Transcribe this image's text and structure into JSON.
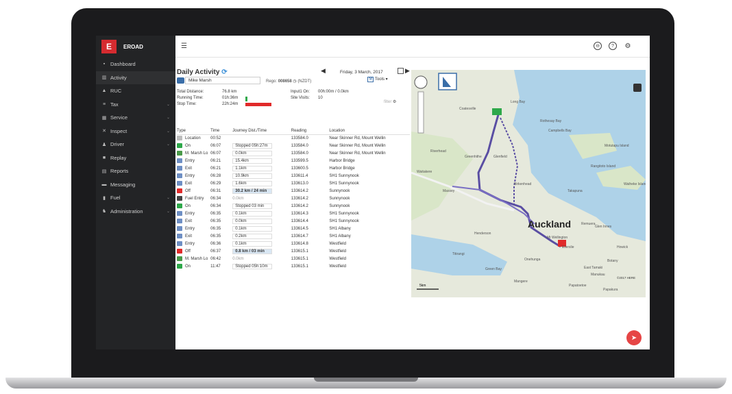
{
  "app": {
    "brand_letter": "E",
    "brand_name": "EROAD"
  },
  "sidebar": {
    "items": [
      {
        "label": "Dashboard",
        "icon": "dashboard-icon",
        "glyph": "▪",
        "chevron": false
      },
      {
        "label": "Activity",
        "icon": "activity-icon",
        "glyph": "▥",
        "chevron": false
      },
      {
        "label": "RUC",
        "icon": "ruc-icon",
        "glyph": "▲",
        "chevron": false
      },
      {
        "label": "Tax",
        "icon": "tax-icon",
        "glyph": "≡",
        "chevron": true
      },
      {
        "label": "Service",
        "icon": "service-icon",
        "glyph": "▦",
        "chevron": true
      },
      {
        "label": "Inspect",
        "icon": "inspect-icon",
        "glyph": "✕",
        "chevron": true
      },
      {
        "label": "Driver",
        "icon": "driver-icon",
        "glyph": "♟",
        "chevron": true
      },
      {
        "label": "Replay",
        "icon": "replay-icon",
        "glyph": "■",
        "chevron": false
      },
      {
        "label": "Reports",
        "icon": "reports-icon",
        "glyph": "▤",
        "chevron": false
      },
      {
        "label": "Messaging",
        "icon": "messaging-icon",
        "glyph": "▬",
        "chevron": false
      },
      {
        "label": "Fuel",
        "icon": "fuel-icon",
        "glyph": "▮",
        "chevron": true
      },
      {
        "label": "Administration",
        "icon": "administration-icon",
        "glyph": "♞",
        "chevron": true
      }
    ]
  },
  "header": {
    "menu_glyph": "☰",
    "icons": [
      "⊖",
      "?",
      "⚙"
    ]
  },
  "activity": {
    "title": "Daily Activity",
    "date": "Friday, 3 March, 2017",
    "driver": "Mike Marsh",
    "rego_label": "Rego:",
    "rego_value": "008658",
    "rego_region": "(NZDT)",
    "tools_label": "Tools",
    "filter_label": "filter",
    "stats": {
      "total_distance_label": "Total Distance:",
      "total_distance": "76.8 km",
      "running_time_label": "Running Time:",
      "running_time": "01h:36m",
      "stop_time_label": "Stop Time:",
      "stop_time": "22h:24m",
      "input_on_label": "Input1 On:",
      "input_on": "00h:00m / 0.0km",
      "site_visits_label": "Site Visits:",
      "site_visits": "10"
    },
    "columns": [
      "Type",
      "Time",
      "Journey Dist./Time",
      "Reading",
      "Location"
    ],
    "rows": [
      {
        "type": "Location",
        "time": "00:52",
        "journey": "",
        "reading": "133584.0",
        "location": "Near Skinner Rd, Mount Wellin",
        "color": "#bdbdbd",
        "boxed": false,
        "hl": false
      },
      {
        "type": "On",
        "time": "06:07",
        "journey": "Stopped  05h:27m",
        "reading": "133584.0",
        "location": "Near Skinner Rd, Mount Wellin",
        "color": "#2ea84a",
        "boxed": true,
        "hl": false
      },
      {
        "type": "M. Marsh Lo",
        "time": "06:07",
        "journey": "0.0km",
        "reading": "133584.0",
        "location": "Near Skinner Rd, Mount Wellin",
        "color": "#4a9a4a",
        "boxed": true,
        "hl": false
      },
      {
        "type": "Entry",
        "time": "06:21",
        "journey": "15.4km",
        "reading": "133599.5",
        "location": "Harbor Bridge",
        "color": "#6e8fc4",
        "boxed": true,
        "hl": false
      },
      {
        "type": "Exit",
        "time": "06:21",
        "journey": "1.1km",
        "reading": "133600.5",
        "location": "Harbor Bridge",
        "color": "#6e8fc4",
        "boxed": true,
        "hl": false
      },
      {
        "type": "Entry",
        "time": "06:28",
        "journey": "10.9km",
        "reading": "133611.4",
        "location": "SH1 Sunnynook",
        "color": "#6e8fc4",
        "boxed": true,
        "hl": false
      },
      {
        "type": "Exit",
        "time": "06:29",
        "journey": "1.6km",
        "reading": "133613.0",
        "location": "SH1 Sunnynook",
        "color": "#6e8fc4",
        "boxed": true,
        "hl": false
      },
      {
        "type": "Off",
        "time": "06:31",
        "journey": "30.2 km  / 24 min",
        "reading": "133614.2",
        "location": "Sunnynook",
        "color": "#e12a2a",
        "boxed": true,
        "hl": true
      },
      {
        "type": "Fuel Entry",
        "time": "06:34",
        "journey": "0.0km",
        "reading": "133614.2",
        "location": "Sunnynook",
        "color": "#444444",
        "boxed": false,
        "hl": false
      },
      {
        "type": "On",
        "time": "06:34",
        "journey": "Stopped  03 min",
        "reading": "133614.2",
        "location": "Sunnynook",
        "color": "#2ea84a",
        "boxed": true,
        "hl": false
      },
      {
        "type": "Entry",
        "time": "06:35",
        "journey": "0.1km",
        "reading": "133614.3",
        "location": "SH1 Sunnynook",
        "color": "#6e8fc4",
        "boxed": true,
        "hl": false
      },
      {
        "type": "Exit",
        "time": "06:35",
        "journey": "0.0km",
        "reading": "133614.4",
        "location": "SH1 Sunnynook",
        "color": "#6e8fc4",
        "boxed": true,
        "hl": false
      },
      {
        "type": "Entry",
        "time": "06:35",
        "journey": "0.1km",
        "reading": "133614.5",
        "location": "SH1 Albany",
        "color": "#6e8fc4",
        "boxed": true,
        "hl": false
      },
      {
        "type": "Exit",
        "time": "06:35",
        "journey": "0.2km",
        "reading": "133614.7",
        "location": "SH1 Albany",
        "color": "#6e8fc4",
        "boxed": true,
        "hl": false
      },
      {
        "type": "Entry",
        "time": "06:36",
        "journey": "0.1km",
        "reading": "133614.8",
        "location": "Westfield",
        "color": "#6e8fc4",
        "boxed": true,
        "hl": false
      },
      {
        "type": "Off",
        "time": "06:37",
        "journey": "0.8 km  / 03 min",
        "reading": "133615.1",
        "location": "Westfield",
        "color": "#e12a2a",
        "boxed": true,
        "hl": true
      },
      {
        "type": "M. Marsh Lo",
        "time": "06:42",
        "journey": "0.0km",
        "reading": "133615.1",
        "location": "Westfield",
        "color": "#4a9a4a",
        "boxed": false,
        "hl": false
      },
      {
        "type": "On",
        "time": "11:47",
        "journey": "Stopped  05h:10m",
        "reading": "133615.1",
        "location": "Westfield",
        "color": "#2ea84a",
        "boxed": true,
        "hl": false
      }
    ]
  },
  "map": {
    "labels": [
      {
        "text": "Auckland",
        "big": true
      },
      {
        "text": "Long Bay",
        "big": false
      },
      {
        "text": "Rothesay Bay",
        "big": false
      },
      {
        "text": "Takapuna",
        "big": false
      },
      {
        "text": "Coatesville",
        "big": false
      },
      {
        "text": "Riverhead",
        "big": false
      },
      {
        "text": "Greenhithe",
        "big": false
      },
      {
        "text": "Glenfield",
        "big": false
      },
      {
        "text": "Waitakere",
        "big": false
      },
      {
        "text": "Massey",
        "big": false
      },
      {
        "text": "Henderson",
        "big": false
      },
      {
        "text": "Titirangi",
        "big": false
      },
      {
        "text": "Rangitoto Island",
        "big": false
      },
      {
        "text": "Motutapu Island",
        "big": false
      },
      {
        "text": "Waiheke Island",
        "big": false
      },
      {
        "text": "Campbells Bay",
        "big": false
      },
      {
        "text": "Birkenhead",
        "big": false
      },
      {
        "text": "Mt Wellington",
        "big": false
      },
      {
        "text": "Glen Innes",
        "big": false
      },
      {
        "text": "Howick",
        "big": false
      },
      {
        "text": "Botany",
        "big": false
      },
      {
        "text": "Manukau",
        "big": false
      },
      {
        "text": "Green Bay",
        "big": false
      },
      {
        "text": "Ellerslie",
        "big": false
      },
      {
        "text": "Remuera",
        "big": false
      },
      {
        "text": "Onehunga",
        "big": false
      },
      {
        "text": "Mangere",
        "big": false
      },
      {
        "text": "Papatoetoe",
        "big": false
      },
      {
        "text": "Papakura",
        "big": false
      },
      {
        "text": "East Tamaki",
        "big": false
      }
    ],
    "scale": "5km",
    "copyright": "©2017 HERE"
  },
  "fab_glyph": "➤"
}
